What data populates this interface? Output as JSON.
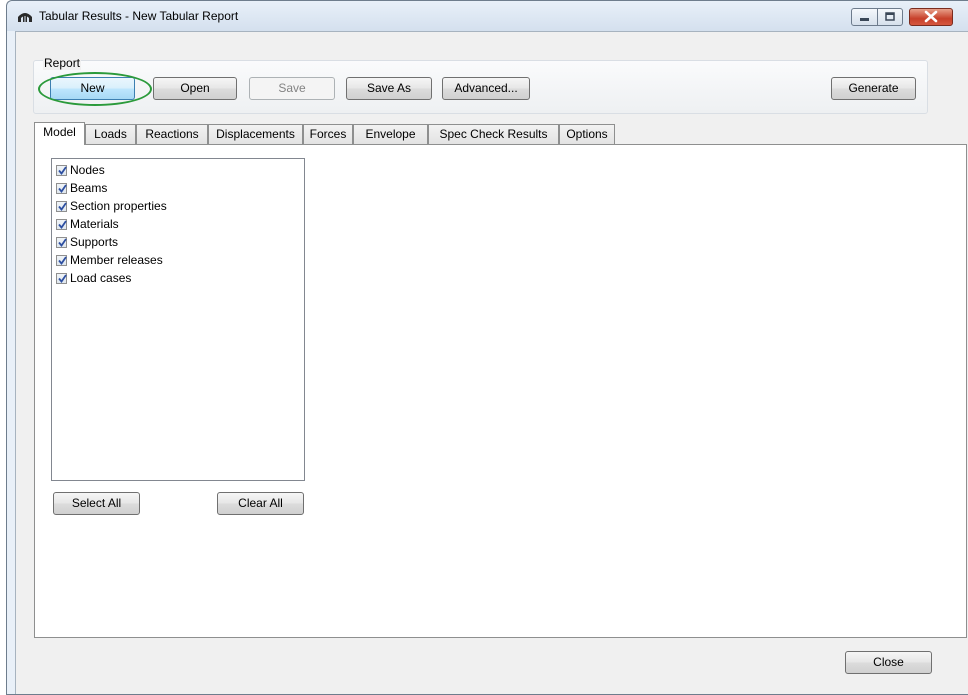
{
  "window": {
    "title": "Tabular Results - New Tabular Report",
    "icon": "bridge-icon"
  },
  "report": {
    "group_label": "Report",
    "buttons": {
      "new": "New",
      "open": "Open",
      "save": "Save",
      "save_as": "Save As",
      "advanced": "Advanced...",
      "generate": "Generate"
    }
  },
  "tabs": [
    {
      "label": "Model",
      "active": true
    },
    {
      "label": "Loads"
    },
    {
      "label": "Reactions"
    },
    {
      "label": "Displacements"
    },
    {
      "label": "Forces"
    },
    {
      "label": "Envelope"
    },
    {
      "label": "Spec Check Results"
    },
    {
      "label": "Options"
    }
  ],
  "model_items": [
    {
      "label": "Nodes",
      "checked": true
    },
    {
      "label": "Beams",
      "checked": true
    },
    {
      "label": "Section properties",
      "checked": true
    },
    {
      "label": "Materials",
      "checked": true
    },
    {
      "label": "Supports",
      "checked": true
    },
    {
      "label": "Member releases",
      "checked": true
    },
    {
      "label": "Load cases",
      "checked": true
    }
  ],
  "panel_buttons": {
    "select_all": "Select All",
    "clear_all": "Clear All"
  },
  "footer": {
    "close": "Close"
  },
  "colors": {
    "highlight_ring": "#2b9a3b",
    "primary_button": "#a7d9f5",
    "close_button": "#c7402a"
  }
}
